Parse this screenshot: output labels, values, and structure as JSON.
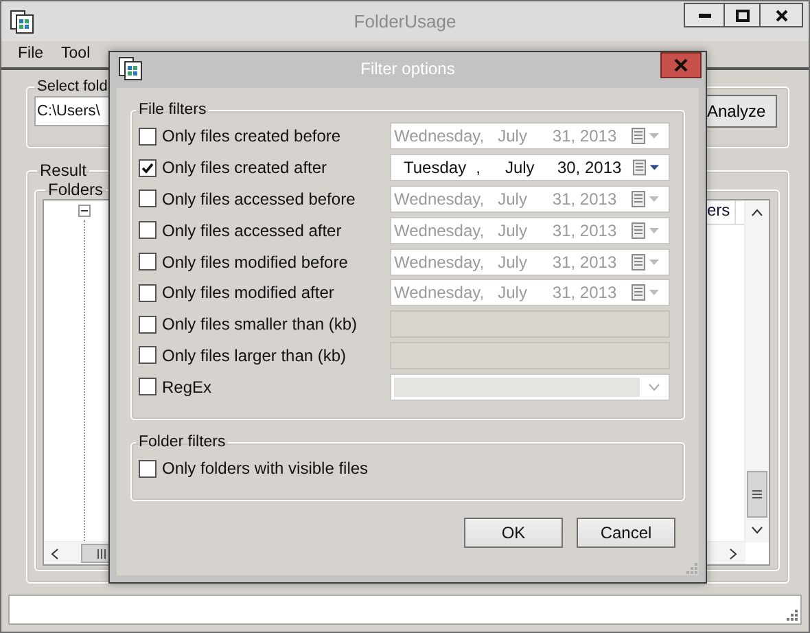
{
  "window": {
    "title": "FolderUsage"
  },
  "menu": [
    {
      "label": "File"
    },
    {
      "label": "Tool"
    }
  ],
  "select_folder": {
    "label": "Select fold",
    "path": "C:\\Users\\",
    "button": "Analyze"
  },
  "result": {
    "label": "Result",
    "folders_label": "Folders",
    "column_header": "ers"
  },
  "dialog": {
    "title": "Filter options",
    "file_filters": {
      "label": "File filters",
      "rows": [
        {
          "kind": "date",
          "label": "Only files created before",
          "checked": false,
          "weekday": "Wednesday,",
          "month": "July",
          "day": "31, 2013"
        },
        {
          "kind": "date",
          "label": "Only files created after",
          "checked": true,
          "weekday": "Tuesday",
          "separator": ",",
          "month": "July",
          "day": "30, 2013"
        },
        {
          "kind": "date",
          "label": "Only files accessed before",
          "checked": false,
          "weekday": "Wednesday,",
          "month": "July",
          "day": "31, 2013"
        },
        {
          "kind": "date",
          "label": "Only files accessed after",
          "checked": false,
          "weekday": "Wednesday,",
          "month": "July",
          "day": "31, 2013"
        },
        {
          "kind": "date",
          "label": "Only files modified before",
          "checked": false,
          "weekday": "Wednesday,",
          "month": "July",
          "day": "31, 2013"
        },
        {
          "kind": "date",
          "label": "Only files modified after",
          "checked": false,
          "weekday": "Wednesday,",
          "month": "July",
          "day": "31, 2013"
        },
        {
          "kind": "number",
          "label": "Only files smaller than (kb)",
          "checked": false
        },
        {
          "kind": "number",
          "label": "Only files larger than (kb)",
          "checked": false
        },
        {
          "kind": "combo",
          "label": "RegEx",
          "checked": false
        }
      ]
    },
    "folder_filters": {
      "label": "Folder filters",
      "rows": [
        {
          "label": "Only folders with visible files",
          "checked": false
        }
      ]
    },
    "buttons": [
      {
        "label": "OK"
      },
      {
        "label": "Cancel"
      }
    ]
  }
}
